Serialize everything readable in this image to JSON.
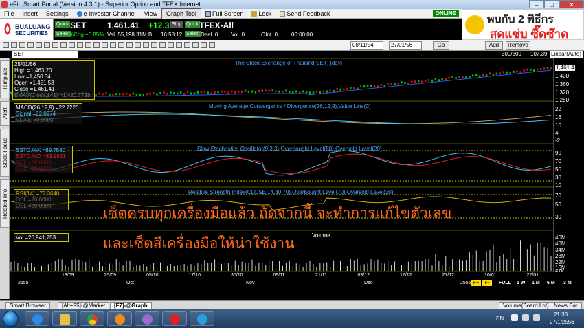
{
  "window": {
    "title": "eFin Smart Portal (Version 4.3.1) - Superior Option and TFEX Internet",
    "minimize": "–",
    "maximize": "□",
    "close": "✕"
  },
  "menu": {
    "items": [
      "File",
      "Insert",
      "Settings",
      "e-Investor Channel",
      "View",
      "Graph Tool",
      "Full Screen",
      "Lock",
      "Send Feedback"
    ],
    "online": "ONLINE"
  },
  "ad": {
    "line1": "พบกับ 2 พิธีกร",
    "line2": "สุดแซ่บ ซี๊ดซ๊าด"
  },
  "logo": {
    "line1": "BUALUANG",
    "line2": "SECURITIES"
  },
  "quote": {
    "set_quick": "Quick",
    "set_select": "Select",
    "set_symbol": "SET",
    "set_price": "1,461.41",
    "set_change": "+12.32",
    "set_pct": "%Chg.+0.85%",
    "set_val": "Val. 55,198.31M B.",
    "set_time": "16:58:12",
    "stop_label": "Stop",
    "tfex_quick": "Quick",
    "tfex_select": "Select",
    "tfex_symbol": "TFEX-All",
    "tfex_deal": "Deal. 0",
    "tfex_vol": "Vol. 0",
    "tfex_oi": "OInt. 0",
    "tfex_time": "00:00:00"
  },
  "toolbar": {
    "date_from": "08/11/54",
    "date_to": "27/01/56",
    "go": "Go",
    "add": "Add",
    "remove": "Remove",
    "count": "300/300",
    "price_tag": "107.39",
    "scale": "Linear(Auto)"
  },
  "symbol_field": "SET",
  "side_tabs": [
    "Template",
    "Alert",
    "Stock Focus",
    "Related Info"
  ],
  "panels": {
    "price": {
      "title": "The Stock Exchange of Thailand(SET) [day]",
      "info": [
        "25/01/56",
        "High  =1,463.20",
        "Low  =1,450.54",
        "Open =1,451.53",
        "Close =1,461.41",
        "EMAV(Close,141) =1,420.7728"
      ],
      "yticks": [
        "1,461.4",
        "1,400",
        "1,360",
        "1,320",
        "1,280"
      ]
    },
    "macd": {
      "title": "Moving Average Convergence / Divergence(26,12,9),Value Line(0)",
      "info": [
        "MACD(26,12,9) =22.7220",
        "Signal  =22.0974",
        "VLINE  =0.0000"
      ],
      "yticks": [
        "22",
        "16",
        "10",
        "4",
        "-2"
      ]
    },
    "stoch": {
      "title": "Slow Stochastics Oscillator(9,3,3),Overbought Level(80),Oversold Level(20)",
      "info": [
        "SSTO.%K  =89.7580",
        "SSTO.%D  =83.9821",
        "OBL  =80.0000",
        "OSL  =20.0000"
      ],
      "yticks": [
        "90",
        "70",
        "50",
        "30",
        "10"
      ]
    },
    "rsi": {
      "title": "Relative Strength Index(CLOSE,14,30,70),Overbought Level(70),Oversold Level(30)",
      "info": [
        "RSI(14)  =77.3640",
        "OBL  =70.0000",
        "OSL  =30.0000"
      ],
      "yticks": [
        "70",
        "50",
        "30"
      ]
    },
    "volume": {
      "title": "Volume",
      "info": [
        "Vol  =20,941,753"
      ],
      "yticks": [
        "46M",
        "40M",
        "34M",
        "28M",
        "22M",
        "16M",
        "6M"
      ]
    }
  },
  "overlay_text": {
    "line1": "เซ็ตครบทุกเครื่องมือแล้ว ถัดจากนี้ จะทำการแก้ไขตัวเลข",
    "line2": "และเซ็ตสีเครื่องมือให้น่าใช้งาน"
  },
  "dates": {
    "ticks": [
      "13/09",
      "25/09",
      "05/10",
      "17/10",
      "30/10",
      "09/11",
      "21/11",
      "03/12",
      "17/12",
      "27/12",
      "10/01",
      "22/01"
    ],
    "months": [
      "2555",
      "Oct",
      "Nov",
      "Dec",
      "2556"
    ],
    "periods": [
      "FULL",
      "1 W",
      "1 M",
      "6 M",
      "3 M"
    ]
  },
  "bottom_tabs": [
    "Smart Browser",
    "[Alt+F5]-@Market",
    "[F7]-@Graph"
  ],
  "bottom_right": {
    "volume_label": "Volume(Board Lot)",
    "news": "News Bar"
  },
  "taskbar": {
    "lang": "EN",
    "time": "21:33",
    "date": "27/1/2556"
  },
  "colors": {
    "price_up": "#00c000",
    "price_down": "#e01010",
    "ema": "#2060ff",
    "macd": "#c8a060",
    "signal": "#40c8ff",
    "stoch_k": "#40c0ff",
    "stoch_d": "#e02020",
    "rsi": "#d4b000",
    "overlay": "#ff6a1a"
  }
}
